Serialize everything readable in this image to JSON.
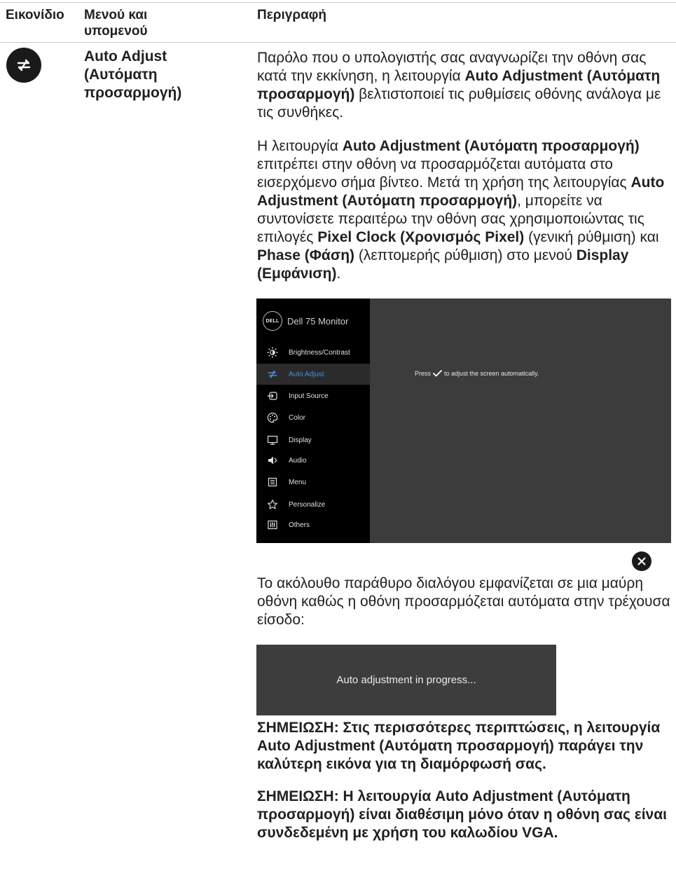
{
  "table_header": {
    "icon_col": "Εικονίδιο",
    "menu_col": "Μενού και υπομενού",
    "desc_col": "Περιγραφή"
  },
  "row": {
    "icon": "auto-adjust-icon",
    "menu_name": "Auto Adjust (Αυτόματη προσαρμογή)",
    "p1": {
      "t1": "Παρόλο που ο υπολογιστής σας αναγνωρίζει την οθόνη σας κατά την εκκίνηση, η λειτουργία ",
      "b1": "Auto Adjustment (Αυτόματη προσαρμογή)",
      "t2": " βελτιστοποιεί τις ρυθμίσεις οθόνης ανάλογα με τις συνθήκες."
    },
    "p2": {
      "t1": "Η λειτουργία ",
      "b1": "Auto Adjustment (Αυτόματη προσαρμογή)",
      "t2": " επιτρέπει στην οθόνη να προσαρμόζεται αυτόματα στο εισερχόμενο σήμα βίντεο. Μετά τη χρήση της λειτουργίας ",
      "b2": "Auto Adjustment (Αυτόματη προσαρμογή)",
      "t3": ", μπορείτε να συντονίσετε περαιτέρω την οθόνη σας χρησιμοποιώντας τις επιλογές ",
      "b3": "Pixel Clock (Χρονισμός Pixel)",
      "t4": " (γενική ρύθμιση) και ",
      "b4": "Phase (Φάση)",
      "t5": " (λεπτομερής ρύθμιση) στο μενού ",
      "b5": "Display (Εμφάνιση)",
      "t6": "."
    },
    "osd": {
      "logo": "DELL",
      "model": "Dell 75 Monitor",
      "menu": [
        {
          "label": "Brightness/Contrast",
          "icon": "brightness-icon"
        },
        {
          "label": "Auto Adjust",
          "icon": "auto-adjust-icon",
          "active": true
        },
        {
          "label": "Input Source",
          "icon": "input-source-icon"
        },
        {
          "label": "Color",
          "icon": "color-palette-icon"
        },
        {
          "label": "Display",
          "icon": "display-icon"
        },
        {
          "label": "Audio",
          "icon": "speaker-icon"
        },
        {
          "label": "Menu",
          "icon": "menu-list-icon"
        },
        {
          "label": "Personalize",
          "icon": "star-icon"
        },
        {
          "label": "Others",
          "icon": "others-icon"
        }
      ],
      "msg_before": "Press",
      "msg_after": "to adjust the screen automatically.",
      "accent": "#4a90e2"
    },
    "close_icon": "close-icon",
    "p3": "Το ακόλουθο παράθυρο διαλόγου εμφανίζεται σε μια μαύρη οθόνη καθώς η οθόνη προσαρμόζεται αυτόματα στην τρέχουσα είσοδο:",
    "progress_text": "Auto adjustment in progress...",
    "note1": "ΣΗΜΕΙΩΣΗ: Στις περισσότερες περιπτώσεις, η λειτουργία Auto Adjustment (Αυτόματη προσαρμογή) παράγει την καλύτερη εικόνα για τη διαμόρφωσή σας.",
    "note2": "ΣΗΜΕΙΩΣΗ: Η λειτουργία Auto Adjustment (Αυτόματη προσαρμογή) είναι διαθέσιμη μόνο όταν η οθόνη σας είναι συνδεδεμένη με χρήση του καλωδίου VGA."
  }
}
